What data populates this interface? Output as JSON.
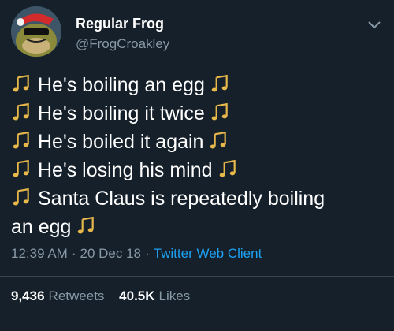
{
  "author": {
    "name": "Regular Frog",
    "handle": "@FrogCroakley",
    "avatar_icon": "frog-santa-avatar"
  },
  "menu_icon": "chevron-down-icon",
  "tweet": {
    "note_icon": "music-note-icon",
    "lines": [
      "He's boiling an egg",
      "He's boiling it twice",
      "He's boiled it again",
      "He's losing his mind",
      "Santa Claus is repeatedly boiling",
      "an egg"
    ]
  },
  "meta": {
    "time": "12:39 AM",
    "date": "20 Dec 18",
    "separator": "·",
    "client": "Twitter Web Client"
  },
  "stats": {
    "retweets_count": "9,436",
    "retweets_label": "Retweets",
    "likes_count": "40.5K",
    "likes_label": "Likes"
  },
  "colors": {
    "background": "#15202b",
    "secondary_text": "#8899a6",
    "link": "#1da1f2",
    "note": "#e8b84a"
  }
}
